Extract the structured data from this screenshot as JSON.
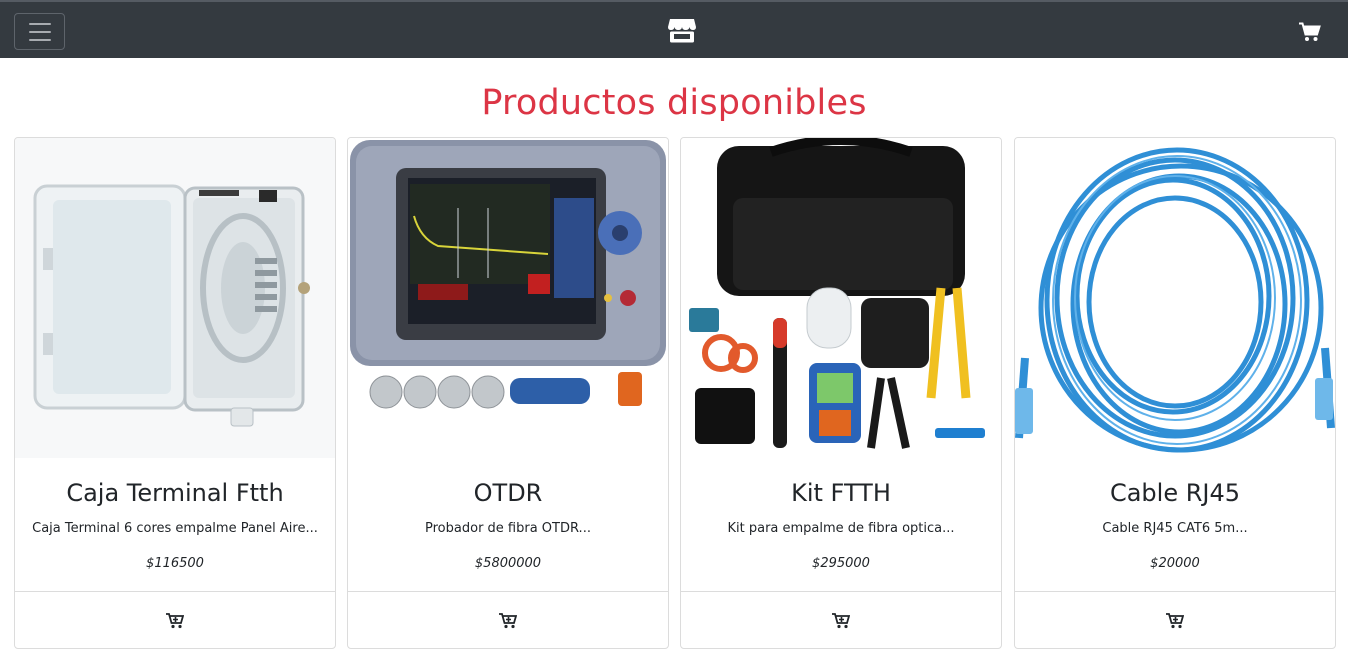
{
  "navbar": {
    "toggler_icon": "hamburger-menu-icon",
    "brand_icon": "store-icon",
    "cart_icon": "shopping-cart-icon"
  },
  "page": {
    "title": "Productos disponibles"
  },
  "colors": {
    "navbar_bg": "#343a40",
    "title_red": "#dc3545"
  },
  "products": [
    {
      "name": "Caja Terminal Ftth",
      "description": "Caja Terminal 6 cores empalme Panel Aire...",
      "price": "$116500",
      "image_icon": "fiber-terminal-box-image",
      "add_icon": "cart-plus-icon"
    },
    {
      "name": "OTDR",
      "description": "Probador de fibra OTDR...",
      "price": "$5800000",
      "image_icon": "otdr-device-image",
      "add_icon": "cart-plus-icon"
    },
    {
      "name": "Kit FTTH",
      "description": "Kit para empalme de fibra optica...",
      "price": "$295000",
      "image_icon": "ftth-tool-kit-image",
      "add_icon": "cart-plus-icon"
    },
    {
      "name": "Cable RJ45",
      "description": "Cable RJ45 CAT6 5m...",
      "price": "$20000",
      "image_icon": "rj45-cable-image",
      "add_icon": "cart-plus-icon"
    }
  ]
}
